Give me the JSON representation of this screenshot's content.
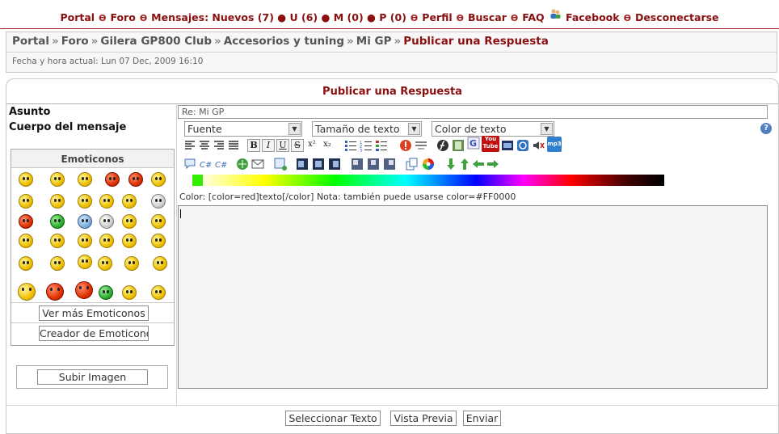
{
  "topnav": {
    "portal": "Portal",
    "foro": "Foro",
    "mensajes": "Mensajes: Nuevos (7) ● U (6) ● M (0) ● P (0)",
    "perfil": "Perfil",
    "buscar": "Buscar",
    "faq": "FAQ",
    "facebook": "Facebook",
    "desconectarse": "Desconectarse"
  },
  "breadcrumb": {
    "items": [
      "Portal",
      "Foro",
      "Gilera GP800 Club",
      "Accesorios y tuning",
      "Mi GP"
    ],
    "current": "Publicar una Respuesta",
    "separator": "»"
  },
  "datetime": "Fecha y hora actual: Lun 07 Dec, 2009 16:10",
  "form": {
    "title": "Publicar una Respuesta",
    "subject_label": "Asunto",
    "subject_value": "Re: Mi GP",
    "body_label": "Cuerpo del mensaje",
    "emoticons_title": "Emoticonos",
    "more_emoticons": "Ver más Emoticonos",
    "emoticon_creator": "Creador de Emoticonos",
    "upload_image": "Subir Imagen",
    "font_select": "Fuente",
    "size_select": "Tamaño de texto",
    "color_select": "Color de texto",
    "help": "?",
    "hint": "Color: [color=red]texto[/color]  Nota: también puede usarse color=#FF0000",
    "select_text": "Seleccionar Texto",
    "preview": "Vista Previa",
    "send": "Enviar"
  },
  "toolbar": {
    "bold": "B",
    "italic": "I",
    "underline": "U",
    "strike": "S",
    "sup": "x²",
    "sub": "x₂",
    "youtube": "You Tube",
    "mp3": "mp3"
  },
  "colors": {
    "accent": "#8a1010",
    "border": "#c8c8c8",
    "swatch": "#33ee00"
  }
}
